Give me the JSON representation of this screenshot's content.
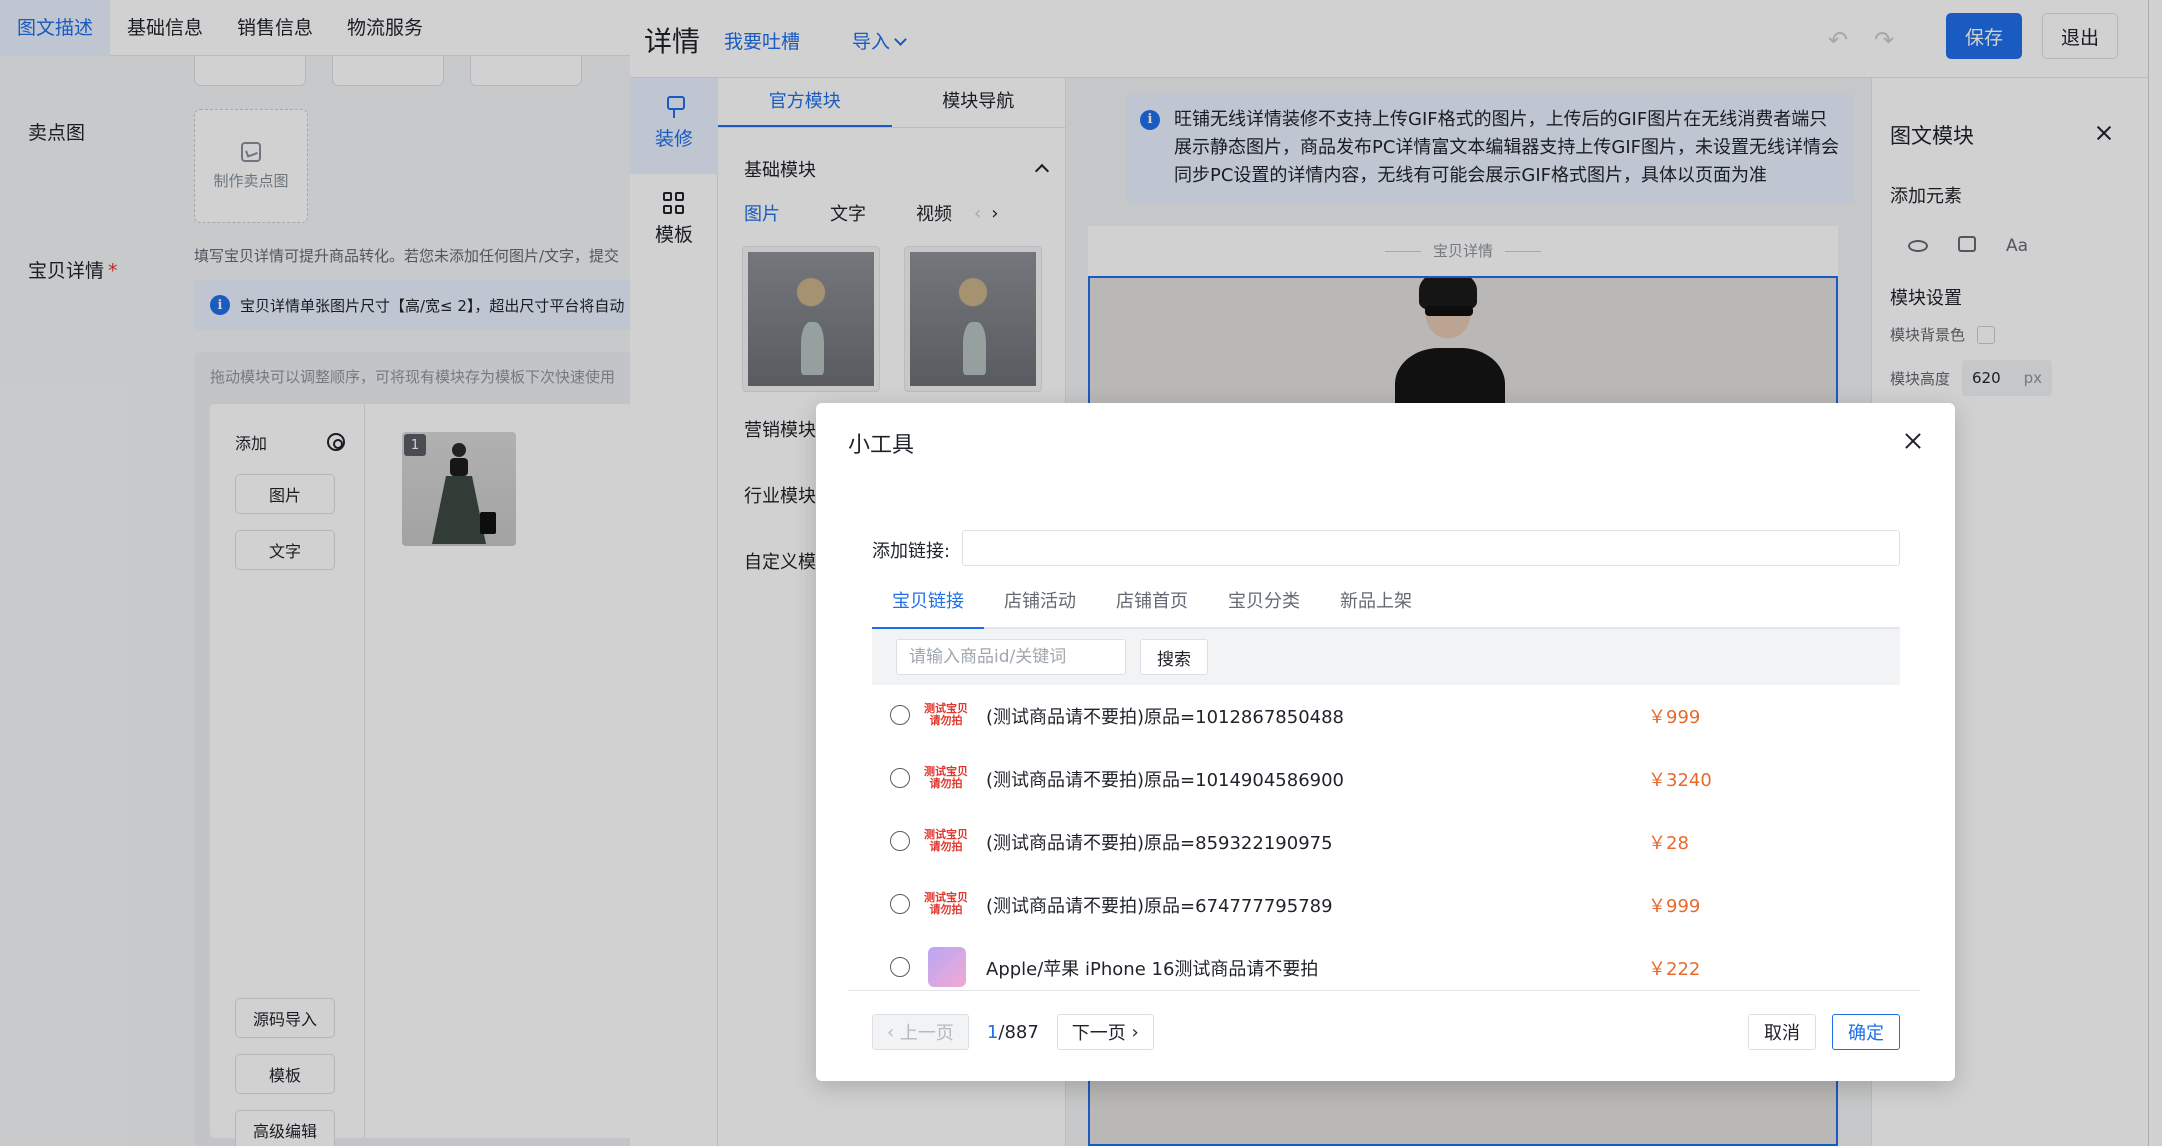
{
  "top_tabs": [
    "图文描述",
    "基础信息",
    "销售信息",
    "物流服务"
  ],
  "form": {
    "selling_image_label": "卖点图",
    "selling_image_button": "制作卖点图",
    "detail_label": "宝贝详情",
    "required_mark": "*",
    "detail_hint": "填写宝贝详情可提升商品转化。若您未添加任何图片/文字，提交",
    "size_notice": "宝贝详情单张图片尺寸【高/宽≤ 2】，超出尺寸平台将自动",
    "drag_hint": "拖动模块可以调整顺序，可将现有模块存为模板下次快速使用",
    "add_label": "添加",
    "add_image_button": "图片",
    "add_text_button": "文字",
    "source_import_button": "源码导入",
    "template_button": "模板",
    "advanced_edit_button": "高级编辑",
    "thumb_index": "1"
  },
  "detail": {
    "title": "详情",
    "feedback_link": "我要吐槽",
    "import_menu": "导入",
    "save_button": "保存",
    "exit_button": "退出",
    "undo_glyph": "↶",
    "redo_glyph": "↷",
    "side_nav": {
      "decorate": "装修",
      "template": "模板"
    },
    "module_tabs": [
      "官方模块",
      "模块导航"
    ],
    "basic_modules": "基础模块",
    "sub_tabs": [
      "图片",
      "文字",
      "视频"
    ],
    "marketing_modules": "营销模块",
    "industry_modules": "行业模块",
    "custom_modules": "自定义模块",
    "gif_notice": "旺铺无线详情装修不支持上传GIF格式的图片，上传后的GIF图片在无线消费者端只展示静态图片，商品发布PC详情富文本编辑器支持上传GIF图片，未设置无线详情会同步PC设置的详情内容，无线有可能会展示GIF格式图片，具体以页面为准",
    "canvas_label": "宝贝详情"
  },
  "props": {
    "title": "图文模块",
    "add_element": "添加元素",
    "module_settings": "模块设置",
    "bg_color_label": "模块背景色",
    "height_label": "模块高度",
    "height_value": "620",
    "height_unit": "px",
    "font_icon_text": "Aa"
  },
  "modal": {
    "title": "小工具",
    "link_label": "添加链接:",
    "tabs": [
      "宝贝链接",
      "店铺活动",
      "店铺首页",
      "宝贝分类",
      "新品上架"
    ],
    "search_placeholder": "请输入商品id/关键词",
    "search_button": "搜索",
    "product_badge": "测试宝贝请勿拍",
    "products": [
      {
        "name": "(测试商品请不要拍)原品=1012867850488",
        "price": "￥999"
      },
      {
        "name": "(测试商品请不要拍)原品=1014904586900",
        "price": "￥3240"
      },
      {
        "name": "(测试商品请不要拍)原品=859322190975",
        "price": "￥28"
      },
      {
        "name": "(测试商品请不要拍)原品=674777795789",
        "price": "￥999"
      },
      {
        "name": "Apple/苹果 iPhone 16测试商品请不要拍",
        "price": "￥222"
      }
    ],
    "prev_page": "上一页",
    "next_page": "下一页",
    "current_page": "1",
    "total_pages": "/887",
    "cancel_button": "取消",
    "ok_button": "确定"
  }
}
